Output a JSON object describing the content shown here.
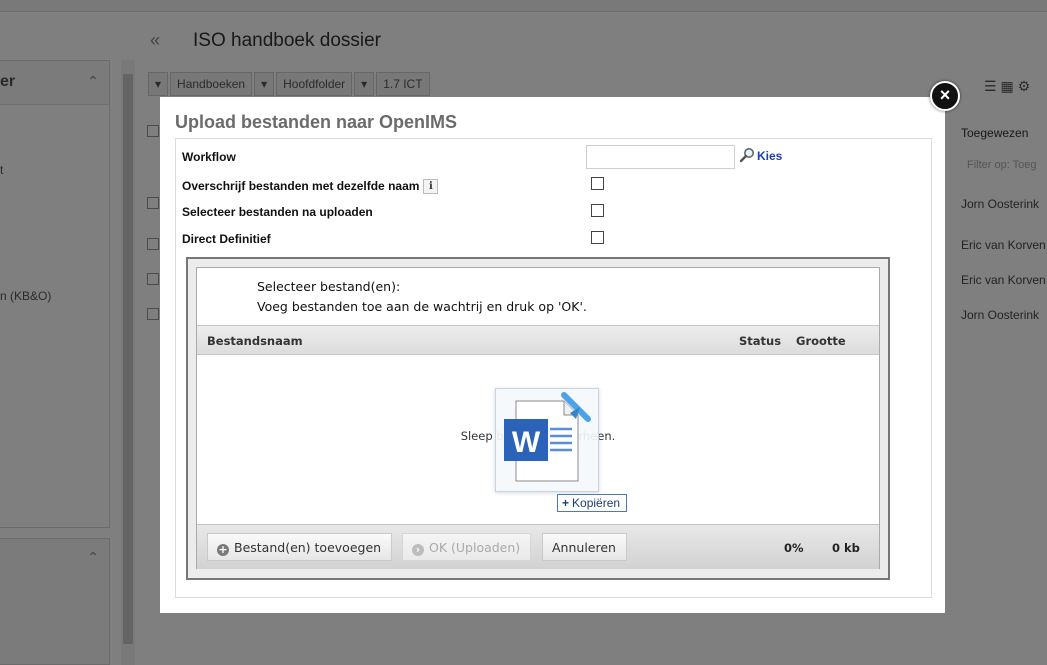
{
  "background": {
    "page_title": "ISO handboek dossier",
    "sidebar": {
      "title": "er",
      "items": [
        "t",
        "n (KB&O)"
      ]
    },
    "toolbar": {
      "buttons": [
        "Handboeken",
        "Hoofdfolder",
        "1.7 ICT"
      ]
    },
    "table": {
      "column_header": "Toegewezen",
      "filter_placeholder": "Filter op: Toeg",
      "rows": [
        "Jorn Oosterink",
        "Eric van Korven",
        "Eric van Korven",
        "Jorn Oosterink"
      ]
    }
  },
  "dialog": {
    "title": "Upload bestanden naar OpenIMS",
    "close_label": "×",
    "fields": {
      "workflow_label": "Workflow",
      "workflow_value": "",
      "kies_label": "Kies",
      "overwrite_label": "Overschrijf bestanden met dezelfde naam",
      "info_label": "i",
      "select_after_label": "Selecteer bestanden na uploaden",
      "direct_definitief_label": "Direct Definitief"
    },
    "uploader": {
      "intro_line1": "Selecteer bestand(en):",
      "intro_line2": "Voeg bestanden toe aan de wachtrij en druk op 'OK'.",
      "columns": {
        "name": "Bestandsnaam",
        "status": "Status",
        "size": "Grootte"
      },
      "drop_text": "Sleep bestanden hierheen.",
      "drag_tooltip": "Kopiëren",
      "buttons": {
        "add": "Bestand(en) toevoegen",
        "ok": "OK (Uploaden)",
        "cancel": "Annuleren"
      },
      "progress_percent": "0%",
      "total_size": "0 kb"
    }
  }
}
